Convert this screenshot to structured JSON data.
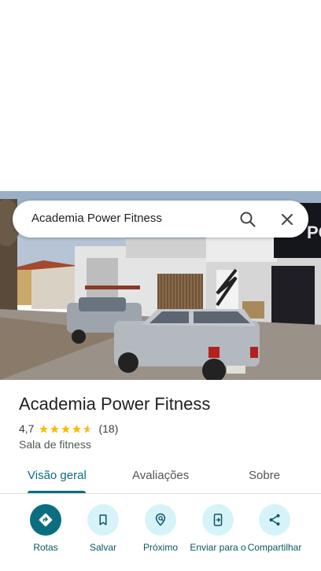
{
  "search": {
    "query": "Academia Power Fitness"
  },
  "place": {
    "name": "Academia Power Fitness",
    "rating": "4,7",
    "review_count": "(18)",
    "stars_value": 4.7,
    "category": "Sala de fitness"
  },
  "tabs": [
    {
      "label": "Visão geral",
      "active": true
    },
    {
      "label": "Avaliações",
      "active": false
    },
    {
      "label": "Sobre",
      "active": false
    }
  ],
  "actions": [
    {
      "label": "Rotas",
      "icon": "directions-icon"
    },
    {
      "label": "Salvar",
      "icon": "bookmark-icon"
    },
    {
      "label": "Próximo",
      "icon": "nearby-icon"
    },
    {
      "label": "Enviar para o",
      "icon": "send-to-phone-icon"
    },
    {
      "label": "Compartilhar",
      "icon": "share-icon"
    }
  ],
  "photo_sign_text": "POWE",
  "colors": {
    "accent": "#0b6e80",
    "star": "#fbbc04",
    "action_bg": "#d7f3fa"
  }
}
